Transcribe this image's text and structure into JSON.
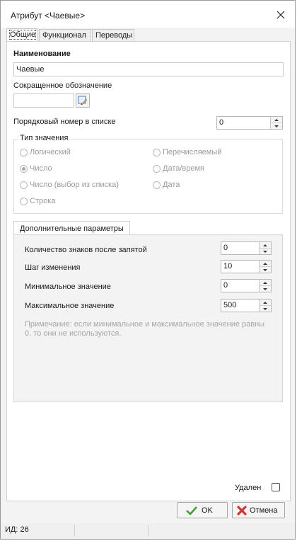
{
  "window": {
    "title": "Атрибут <Чаевые>"
  },
  "tabs": [
    "Общие",
    "Функционал",
    "Переводы"
  ],
  "general": {
    "name_label": "Наименование",
    "name_value": "Чаевые",
    "short_label": "Сокращенное обозначение",
    "short_value": "",
    "order_label": "Порядковый номер в списке",
    "order_value": "0"
  },
  "value_type": {
    "title": "Тип значения",
    "options": [
      "Логический",
      "Число",
      "Число (выбор из списка)",
      "Строка",
      "Перечисляемый",
      "Дата/время",
      "Дата"
    ],
    "selected": "Число"
  },
  "additional": {
    "tab_label": "Дополнительные параметры",
    "decimals_label": "Количество знаков после запятой",
    "decimals_value": "0",
    "step_label": "Шаг изменения",
    "step_value": "10",
    "min_label": "Минимальное значение",
    "min_value": "0",
    "max_label": "Максимальное значение",
    "max_value": "500",
    "note": "Примечание: если минимальное и максимальное значение равны 0, то они не используются."
  },
  "deleted": {
    "label": "Удален",
    "checked": false
  },
  "buttons": {
    "ok": "OK",
    "cancel": "Отмена"
  },
  "status": {
    "id_text": "ИД: 26"
  },
  "colors": {
    "ok_icon": "#3fa12f",
    "cancel_icon": "#d8322b"
  }
}
